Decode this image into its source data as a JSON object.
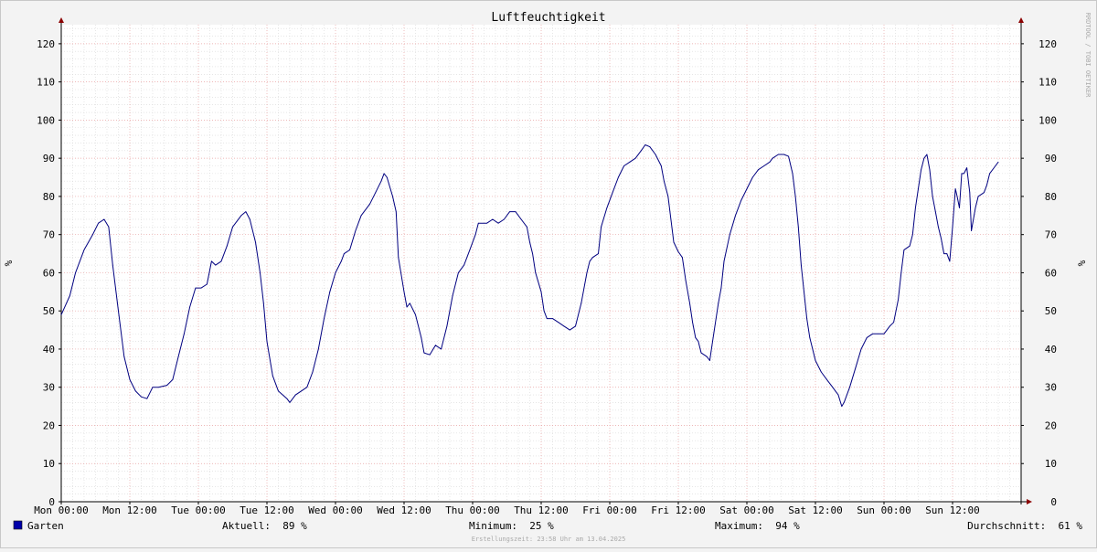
{
  "watermark": "RRDTOOL / TOBI OETIKER",
  "footer": {
    "legend_label": "Garten",
    "legend_color": "#0000aa",
    "current": "Aktuell:  89 %",
    "minimum": "Minimum:  25 %",
    "maximum": "Maximum:  94 %",
    "average": "Durchschnitt:  61 %",
    "created": "Erstellungszeit: 23:58 Uhr am 13.04.2025"
  },
  "colors": {
    "background": "#f3f3f3",
    "plot_background": "#ffffff",
    "line": "#000080",
    "grid_major": "#e8a0a0",
    "grid_minor": "#d8d8d8",
    "axis": "#000000",
    "arrow": "#8b0000"
  },
  "chart_data": {
    "type": "line",
    "title": "Luftfeuchtigkeit",
    "ylabel": "%",
    "xlabel": "",
    "ylim": [
      0,
      125
    ],
    "xlim": [
      0,
      168
    ],
    "x_unit": "hours since Mon 00:00",
    "yticks": [
      0,
      10,
      20,
      30,
      40,
      50,
      60,
      70,
      80,
      90,
      100,
      110,
      120
    ],
    "xticks": [
      {
        "x": 0,
        "label": "Mon 00:00"
      },
      {
        "x": 12,
        "label": "Mon 12:00"
      },
      {
        "x": 24,
        "label": "Tue 00:00"
      },
      {
        "x": 36,
        "label": "Tue 12:00"
      },
      {
        "x": 48,
        "label": "Wed 00:00"
      },
      {
        "x": 60,
        "label": "Wed 12:00"
      },
      {
        "x": 72,
        "label": "Thu 00:00"
      },
      {
        "x": 84,
        "label": "Thu 12:00"
      },
      {
        "x": 96,
        "label": "Fri 00:00"
      },
      {
        "x": 108,
        "label": "Fri 12:00"
      },
      {
        "x": 120,
        "label": "Sat 00:00"
      },
      {
        "x": 132,
        "label": "Sat 12:00"
      },
      {
        "x": 144,
        "label": "Sun 00:00"
      },
      {
        "x": 156,
        "label": "Sun 12:00"
      }
    ],
    "grid": true,
    "legend": "bottom-left",
    "series": [
      {
        "name": "Garten",
        "color": "#000080",
        "points": [
          [
            0,
            49
          ],
          [
            1.5,
            54
          ],
          [
            2.5,
            60
          ],
          [
            4,
            66
          ],
          [
            5.5,
            70
          ],
          [
            6.5,
            73
          ],
          [
            7.5,
            74
          ],
          [
            8.3,
            72
          ],
          [
            9,
            62
          ],
          [
            10,
            50
          ],
          [
            11,
            38
          ],
          [
            12,
            32
          ],
          [
            13,
            29
          ],
          [
            14,
            27.5
          ],
          [
            15,
            27
          ],
          [
            16,
            30
          ],
          [
            17,
            30
          ],
          [
            18.5,
            30.5
          ],
          [
            19.5,
            32
          ],
          [
            20.5,
            38
          ],
          [
            21.5,
            44
          ],
          [
            22.5,
            51
          ],
          [
            23.5,
            56
          ],
          [
            24.5,
            56
          ],
          [
            25.5,
            57
          ],
          [
            26.3,
            63
          ],
          [
            27,
            62
          ],
          [
            28,
            63
          ],
          [
            29,
            67
          ],
          [
            30,
            72
          ],
          [
            31.5,
            75
          ],
          [
            32.3,
            76
          ],
          [
            33,
            74
          ],
          [
            34,
            68
          ],
          [
            34.8,
            60
          ],
          [
            35.4,
            52
          ],
          [
            36,
            42
          ],
          [
            37,
            33
          ],
          [
            38,
            29
          ],
          [
            39.5,
            27
          ],
          [
            40,
            26
          ],
          [
            41,
            28
          ],
          [
            42,
            29
          ],
          [
            43,
            30
          ],
          [
            44,
            34
          ],
          [
            45,
            40
          ],
          [
            46,
            48
          ],
          [
            47,
            55
          ],
          [
            48,
            60
          ],
          [
            49,
            63
          ],
          [
            49.5,
            65
          ],
          [
            50.5,
            66
          ],
          [
            51.5,
            71
          ],
          [
            52.5,
            75
          ],
          [
            54,
            78
          ],
          [
            55,
            81
          ],
          [
            56,
            84
          ],
          [
            56.5,
            86
          ],
          [
            57,
            85
          ],
          [
            58,
            80
          ],
          [
            58.6,
            76
          ],
          [
            59,
            64
          ],
          [
            60,
            55
          ],
          [
            60.5,
            51
          ],
          [
            61,
            52
          ],
          [
            62,
            49
          ],
          [
            63,
            43
          ],
          [
            63.5,
            39
          ],
          [
            64.5,
            38.5
          ],
          [
            65.5,
            41
          ],
          [
            66.5,
            40
          ],
          [
            67.5,
            46
          ],
          [
            68.5,
            54
          ],
          [
            69.5,
            60
          ],
          [
            70.5,
            62
          ],
          [
            71.5,
            66
          ],
          [
            72.5,
            70
          ],
          [
            73,
            73
          ],
          [
            74.5,
            73
          ],
          [
            75.5,
            74
          ],
          [
            76.5,
            73
          ],
          [
            77.5,
            74
          ],
          [
            78.5,
            76
          ],
          [
            79.5,
            76
          ],
          [
            80.5,
            74
          ],
          [
            81.5,
            72
          ],
          [
            82,
            68
          ],
          [
            82.5,
            65
          ],
          [
            83,
            60
          ],
          [
            84,
            55
          ],
          [
            84.5,
            50
          ],
          [
            85,
            48
          ],
          [
            86,
            48
          ],
          [
            87,
            47
          ],
          [
            88,
            46
          ],
          [
            89,
            45
          ],
          [
            90,
            46
          ],
          [
            91,
            52
          ],
          [
            92,
            60
          ],
          [
            92.5,
            63
          ],
          [
            93,
            64
          ],
          [
            94,
            65
          ],
          [
            94.5,
            72
          ],
          [
            95.5,
            77
          ],
          [
            96.5,
            81
          ],
          [
            97.5,
            85
          ],
          [
            98.5,
            88
          ],
          [
            99.5,
            89
          ],
          [
            100.5,
            90
          ],
          [
            101.5,
            92
          ],
          [
            102.2,
            93.5
          ],
          [
            103,
            93
          ],
          [
            104,
            91
          ],
          [
            105,
            88
          ],
          [
            105.5,
            84
          ],
          [
            106.2,
            80
          ],
          [
            106.7,
            74
          ],
          [
            107.2,
            68
          ],
          [
            108,
            65.5
          ],
          [
            108.7,
            64
          ],
          [
            109.3,
            58
          ],
          [
            110,
            52
          ],
          [
            110.5,
            47
          ],
          [
            111,
            43
          ],
          [
            111.5,
            42
          ],
          [
            112,
            39
          ],
          [
            113,
            38
          ],
          [
            113.5,
            37
          ],
          [
            114,
            42
          ],
          [
            115,
            52
          ],
          [
            115.5,
            56
          ],
          [
            116,
            63
          ],
          [
            117,
            70
          ],
          [
            118,
            75
          ],
          [
            119,
            79
          ],
          [
            120,
            82
          ],
          [
            121,
            85
          ],
          [
            122,
            87
          ],
          [
            123,
            88
          ],
          [
            124,
            89
          ],
          [
            124.5,
            90
          ],
          [
            125.5,
            91
          ],
          [
            126.5,
            91
          ],
          [
            127.3,
            90.5
          ],
          [
            128,
            86
          ],
          [
            128.5,
            80
          ],
          [
            129,
            72
          ],
          [
            129.5,
            62
          ],
          [
            130,
            55
          ],
          [
            130.5,
            48
          ],
          [
            131,
            43
          ],
          [
            132,
            37
          ],
          [
            133,
            34
          ],
          [
            134,
            32
          ],
          [
            135,
            30
          ],
          [
            135.5,
            29
          ],
          [
            136,
            28
          ],
          [
            136.6,
            25
          ],
          [
            137,
            26
          ],
          [
            138,
            30
          ],
          [
            139,
            35
          ],
          [
            140,
            40
          ],
          [
            141,
            43
          ],
          [
            142,
            44
          ],
          [
            143,
            44
          ],
          [
            144,
            44
          ],
          [
            145,
            46
          ],
          [
            145.7,
            47
          ],
          [
            146.5,
            53
          ],
          [
            147,
            60
          ],
          [
            147.5,
            66
          ],
          [
            148.5,
            67
          ],
          [
            149,
            70
          ],
          [
            149.5,
            77
          ],
          [
            150,
            82
          ],
          [
            150.5,
            87
          ],
          [
            151,
            90
          ],
          [
            151.5,
            91
          ],
          [
            152,
            87
          ],
          [
            152.5,
            80
          ],
          [
            153,
            76
          ],
          [
            153.5,
            72
          ],
          [
            154,
            69
          ],
          [
            154.5,
            65
          ],
          [
            155,
            65
          ],
          [
            155.5,
            63
          ],
          [
            156,
            72
          ],
          [
            156.5,
            82
          ],
          [
            156.8,
            80
          ],
          [
            157.2,
            77
          ],
          [
            157.6,
            86
          ],
          [
            158,
            86
          ],
          [
            158.5,
            87.5
          ],
          [
            159,
            81
          ],
          [
            159.3,
            71
          ],
          [
            160,
            77
          ],
          [
            160.5,
            80
          ],
          [
            161.5,
            81
          ],
          [
            162,
            83
          ],
          [
            162.5,
            86
          ],
          [
            163.5,
            88
          ],
          [
            164,
            89
          ]
        ]
      }
    ]
  }
}
